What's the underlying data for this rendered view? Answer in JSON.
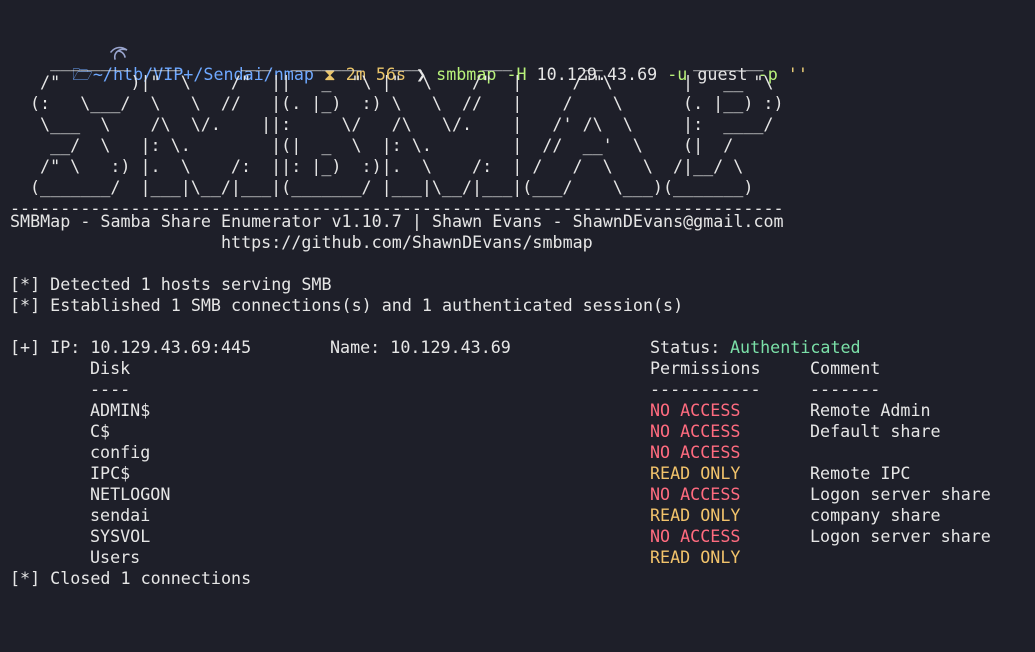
{
  "prompt": {
    "path": "~/htb/VIP+/Sendai/nmap",
    "duration": "2m 56s",
    "arrow": "❯",
    "cmd": "smbmap",
    "flag_h": "-H",
    "host": "10.129.43.69",
    "flag_u": "-u",
    "user": "guest",
    "flag_p": "-p",
    "pass": "''"
  },
  "banner": [
    "  ________  ___      ___  _______   ___      ___       __         _______",
    " /\"       )|\"  \\    /\"  ||   _  \"\\ |\"  \\    /\"  |     /\"\"\\       |   __ \"\\",
    "(:   \\___/  \\   \\  //   |(. |_)  :) \\   \\  //   |    /    \\      (. |__) :)",
    " \\___  \\    /\\  \\/.    ||:     \\/   /\\   \\/.    |   /' /\\  \\     |:  ____/",
    "  __/  \\   |: \\.        |(|  _  \\  |: \\.        |  //  __'  \\    (|  /",
    " /\" \\   :) |.  \\    /:  ||: |_)  :)|.  \\    /:  | /   /  \\   \\  /|__/ \\",
    "(_______/  |___|\\__/|___|(_______/ |___|\\__/|___|(___/    \\___)(_______)"
  ],
  "separator": "-----------------------------------------------------------------------------",
  "header_line1": "SMBMap - Samba Share Enumerator v1.10.7 | Shawn Evans - ShawnDEvans@gmail.com",
  "header_line2": "                     https://github.com/ShawnDEvans/smbmap",
  "detected": "[*] Detected 1 hosts serving SMB",
  "established": "[*] Established 1 SMB connections(s) and 1 authenticated session(s)",
  "target": {
    "ip_label": "[+] IP: 10.129.43.69:445",
    "name_label": "Name: 10.129.43.69",
    "status_label": "Status:",
    "status_value": "Authenticated"
  },
  "table": {
    "headers": {
      "disk": "Disk",
      "permissions": "Permissions",
      "comment": "Comment"
    },
    "underlines": {
      "disk": "----",
      "permissions": "-----------",
      "comment": "-------"
    },
    "rows": [
      {
        "disk": "ADMIN$",
        "permissions": "NO ACCESS",
        "comment": "Remote Admin",
        "level": "red"
      },
      {
        "disk": "C$",
        "permissions": "NO ACCESS",
        "comment": "Default share",
        "level": "red"
      },
      {
        "disk": "config",
        "permissions": "NO ACCESS",
        "comment": "",
        "level": "red"
      },
      {
        "disk": "IPC$",
        "permissions": "READ ONLY",
        "comment": "Remote IPC",
        "level": "yellow"
      },
      {
        "disk": "NETLOGON",
        "permissions": "NO ACCESS",
        "comment": "Logon server share",
        "level": "red"
      },
      {
        "disk": "sendai",
        "permissions": "READ ONLY",
        "comment": "company share",
        "level": "yellow"
      },
      {
        "disk": "SYSVOL",
        "permissions": "NO ACCESS",
        "comment": "Logon server share",
        "level": "red"
      },
      {
        "disk": "Users",
        "permissions": "READ ONLY",
        "comment": "",
        "level": "yellow"
      }
    ]
  },
  "closed": "[*] Closed 1 connections",
  "colors": {
    "background": "#1e1f29",
    "authenticated": "#7be0a8",
    "no_access": "#ff6b7f",
    "read_only": "#f2c36b"
  }
}
